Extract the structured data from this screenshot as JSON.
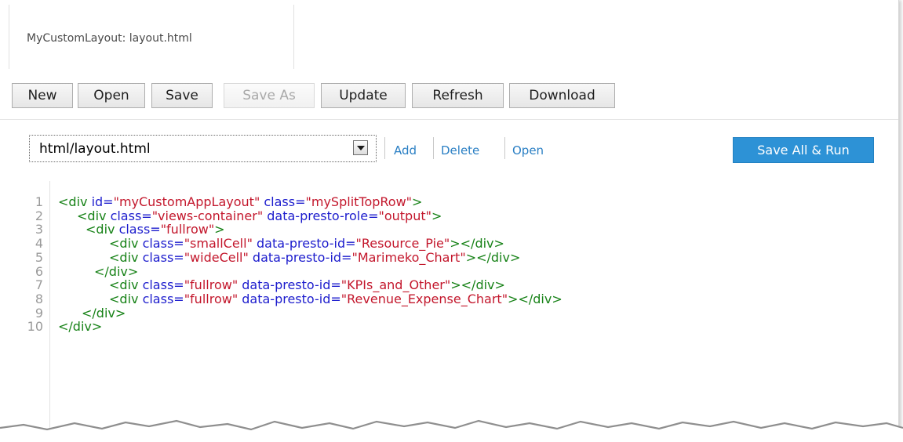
{
  "tab": {
    "label": "MyCustomLayout: layout.html"
  },
  "toolbar": {
    "new": "New",
    "open": "Open",
    "save": "Save",
    "save_as": "Save As",
    "update": "Update",
    "refresh": "Refresh",
    "download": "Download"
  },
  "filebar": {
    "selected_file": "html/layout.html",
    "add": "Add",
    "delete": "Delete",
    "open": "Open",
    "save_all_run": "Save All & Run"
  },
  "editor": {
    "lines": [
      [
        {
          "t": "t",
          "s": "<div "
        },
        {
          "t": "a",
          "s": "id="
        },
        {
          "t": "v",
          "s": "\"myCustomAppLayout\""
        },
        {
          "t": "a",
          "s": " class="
        },
        {
          "t": "v",
          "s": "\"mySplitTopRow\""
        },
        {
          "t": "t",
          "s": ">"
        }
      ],
      [
        {
          "t": "t",
          "s": "<div "
        },
        {
          "t": "a",
          "s": "class="
        },
        {
          "t": "v",
          "s": "\"views-container\""
        },
        {
          "t": "a",
          "s": " data-presto-role="
        },
        {
          "t": "v",
          "s": "\"output\""
        },
        {
          "t": "t",
          "s": ">"
        }
      ],
      [
        {
          "t": "t",
          "s": "<div "
        },
        {
          "t": "a",
          "s": "class="
        },
        {
          "t": "v",
          "s": "\"fullrow\""
        },
        {
          "t": "t",
          "s": ">"
        }
      ],
      [
        {
          "t": "t",
          "s": "<div "
        },
        {
          "t": "a",
          "s": "class="
        },
        {
          "t": "v",
          "s": "\"smallCell\""
        },
        {
          "t": "a",
          "s": " data-presto-id="
        },
        {
          "t": "v",
          "s": "\"Resource_Pie\""
        },
        {
          "t": "t",
          "s": "></div>"
        }
      ],
      [
        {
          "t": "t",
          "s": "<div "
        },
        {
          "t": "a",
          "s": "class="
        },
        {
          "t": "v",
          "s": "\"wideCell\""
        },
        {
          "t": "a",
          "s": " data-presto-id="
        },
        {
          "t": "v",
          "s": "\"Marimeko_Chart\""
        },
        {
          "t": "t",
          "s": "></div>"
        }
      ],
      [
        {
          "t": "t",
          "s": "</div>"
        }
      ],
      [
        {
          "t": "t",
          "s": "<div "
        },
        {
          "t": "a",
          "s": "class="
        },
        {
          "t": "v",
          "s": "\"fullrow\""
        },
        {
          "t": "a",
          "s": " data-presto-id="
        },
        {
          "t": "v",
          "s": "\"KPIs_and_Other\""
        },
        {
          "t": "t",
          "s": "></div>"
        }
      ],
      [
        {
          "t": "t",
          "s": "<div "
        },
        {
          "t": "a",
          "s": "class="
        },
        {
          "t": "v",
          "s": "\"fullrow\""
        },
        {
          "t": "a",
          "s": " data-presto-id="
        },
        {
          "t": "v",
          "s": "\"Revenue_Expense_Chart\""
        },
        {
          "t": "t",
          "s": "></div>"
        }
      ],
      [
        {
          "t": "t",
          "s": "</div>"
        }
      ],
      [
        {
          "t": "t",
          "s": "</div>"
        }
      ]
    ],
    "line_numbers": [
      "1",
      "2",
      "3",
      "4",
      "5",
      "6",
      "7",
      "8",
      "9",
      "10"
    ]
  },
  "colors": {
    "tag": "#178217",
    "attribute": "#1c1ccd",
    "value": "#c3172c",
    "accent": "#2d92d6",
    "link": "#2a7fc4"
  }
}
